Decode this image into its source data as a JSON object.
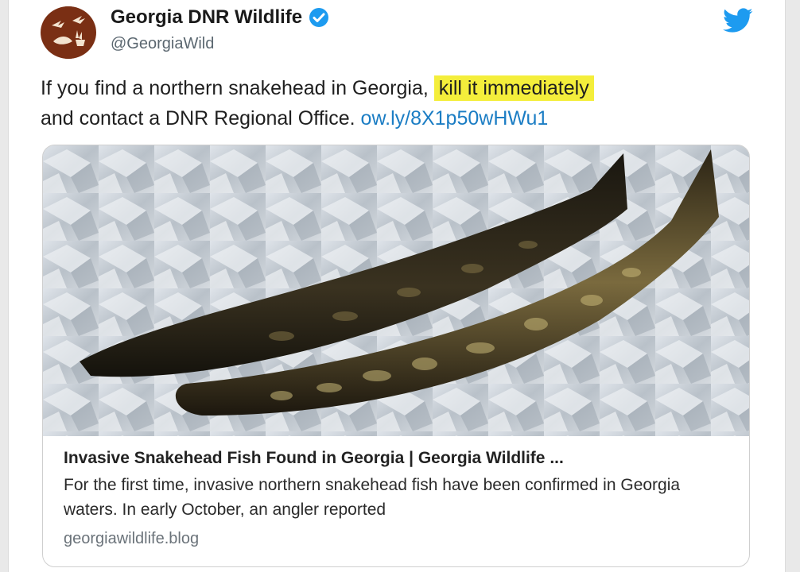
{
  "account": {
    "display_name": "Georgia DNR Wildlife",
    "handle": "@GeorgiaWild",
    "verified": true,
    "avatar_icon": "wildlife-logo-icon",
    "avatar_color": "#7a2f14"
  },
  "tweet": {
    "text_before": "If you find a northern snakehead in Georgia,",
    "text_highlight": "kill it immediately",
    "text_after": "and contact a DNR Regional Office.",
    "link_text": "ow.ly/8X1p50wHWu1",
    "highlight_color": "#f4ee3b",
    "link_color": "#1b7dc4"
  },
  "card": {
    "image_icon": "snakehead-fish-photo",
    "title": "Invasive Snakehead Fish Found in Georgia | Georgia Wildlife ...",
    "description": "For the first time, invasive northern snakehead fish have been confirmed in Georgia waters. In early October, an angler reported",
    "domain": "georgiawildlife.blog"
  },
  "brand": {
    "twitter_icon": "twitter-bird-icon",
    "twitter_color": "#1d9bf0"
  }
}
